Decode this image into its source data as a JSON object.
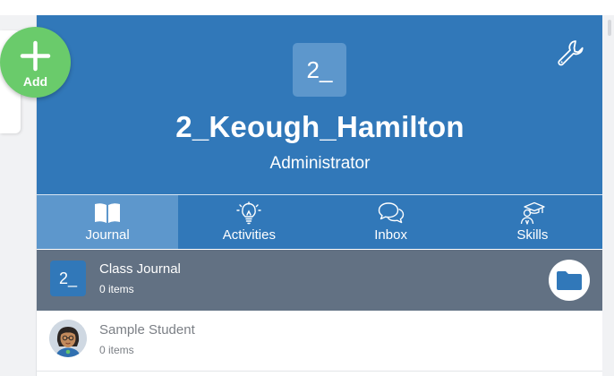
{
  "add_button": {
    "label": "Add"
  },
  "header": {
    "avatar_text": "2_",
    "name": "2_Keough_Hamilton",
    "role": "Administrator",
    "settings_icon": "wrench-icon"
  },
  "tabs": [
    {
      "label": "Journal",
      "icon": "book-icon",
      "active": true
    },
    {
      "label": "Activities",
      "icon": "lightbulb-icon",
      "active": false
    },
    {
      "label": "Inbox",
      "icon": "chat-bubbles-icon",
      "active": false
    },
    {
      "label": "Skills",
      "icon": "graduate-icon",
      "active": false
    }
  ],
  "rows": [
    {
      "avatar_text": "2_",
      "title": "Class Journal",
      "subtitle": "0 items",
      "action_icon": "folder-icon"
    },
    {
      "avatar_icon": "student-avatar-icon",
      "title": "Sample Student",
      "subtitle": "0 items"
    }
  ],
  "colors": {
    "header_blue": "#3178b9",
    "active_tab": "#5d97cc",
    "journal_row": "#627183",
    "add_green": "#6acb6b"
  }
}
